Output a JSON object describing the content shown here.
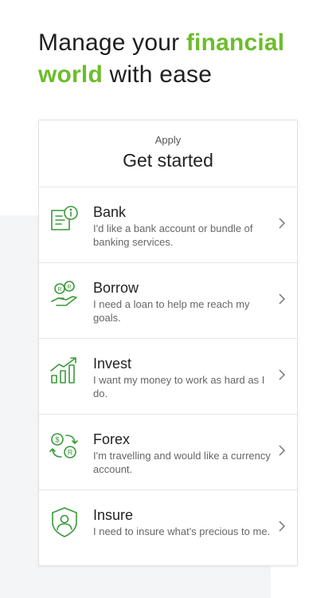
{
  "headline": {
    "part1": "Manage your ",
    "accent1": "financial",
    "break_accent": "world",
    "part2": " with ease"
  },
  "card": {
    "kicker": "Apply",
    "title": "Get started",
    "options": [
      {
        "title": "Bank",
        "description": "I'd like a bank account or bundle of banking services.",
        "icon": "document-info-icon"
      },
      {
        "title": "Borrow",
        "description": "I need a loan to help me reach my goals.",
        "icon": "coins-hand-icon"
      },
      {
        "title": "Invest",
        "description": "I want my money to work as hard as I do.",
        "icon": "growth-chart-icon"
      },
      {
        "title": "Forex",
        "description": "I'm travelling and would like a currency account.",
        "icon": "currency-exchange-icon"
      },
      {
        "title": "Insure",
        "description": "I need to insure what's precious to me.",
        "icon": "shield-person-icon"
      }
    ]
  },
  "colors": {
    "accent": "#6cbd2b",
    "icon": "#3a9a3a"
  }
}
